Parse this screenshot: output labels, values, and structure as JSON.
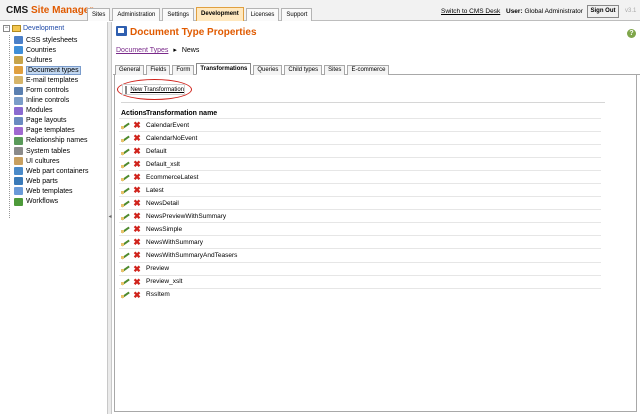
{
  "app": {
    "brand_cms": "CMS",
    "brand_sm": "Site Manager",
    "version": "v3.1"
  },
  "top_tabs": [
    {
      "label": "Sites",
      "active": false
    },
    {
      "label": "Administration",
      "active": false
    },
    {
      "label": "Settings",
      "active": false
    },
    {
      "label": "Development",
      "active": true
    },
    {
      "label": "Licenses",
      "active": false
    },
    {
      "label": "Support",
      "active": false
    }
  ],
  "header": {
    "switch_link": "Switch to CMS Desk",
    "user_prefix": "User:",
    "user_name": "Global Administrator",
    "signout_label": "Sign Out"
  },
  "tree": {
    "root_label": "Development",
    "items": [
      {
        "label": "CSS stylesheets",
        "icon": "stylesheet-icon",
        "color": "#4a7fc8",
        "selected": false
      },
      {
        "label": "Countries",
        "icon": "globe-icon",
        "color": "#3f8fd8",
        "selected": false
      },
      {
        "label": "Cultures",
        "icon": "culture-icon",
        "color": "#c7a44a",
        "selected": false
      },
      {
        "label": "Document types",
        "icon": "document-type-icon",
        "color": "#e0a040",
        "selected": true
      },
      {
        "label": "E-mail templates",
        "icon": "email-icon",
        "color": "#d6b56a",
        "selected": false
      },
      {
        "label": "Form controls",
        "icon": "form-control-icon",
        "color": "#5a7fb0",
        "selected": false
      },
      {
        "label": "Inline controls",
        "icon": "inline-control-icon",
        "color": "#7a9cc8",
        "selected": false
      },
      {
        "label": "Modules",
        "icon": "module-icon",
        "color": "#8a6ad0",
        "selected": false
      },
      {
        "label": "Page layouts",
        "icon": "page-layout-icon",
        "color": "#6a8ac0",
        "selected": false
      },
      {
        "label": "Page templates",
        "icon": "page-template-icon",
        "color": "#a06ad0",
        "selected": false
      },
      {
        "label": "Relationship names",
        "icon": "relationship-icon",
        "color": "#5a9a5a",
        "selected": false
      },
      {
        "label": "System tables",
        "icon": "system-table-icon",
        "color": "#8a8a8a",
        "selected": false
      },
      {
        "label": "UI cultures",
        "icon": "ui-culture-icon",
        "color": "#c8a060",
        "selected": false
      },
      {
        "label": "Web part containers",
        "icon": "webpart-container-icon",
        "color": "#4a8ac8",
        "selected": false
      },
      {
        "label": "Web parts",
        "icon": "webpart-icon",
        "color": "#3a7ab8",
        "selected": false
      },
      {
        "label": "Web templates",
        "icon": "web-template-icon",
        "color": "#6a9ad8",
        "selected": false
      },
      {
        "label": "Workflows",
        "icon": "workflow-icon",
        "color": "#4d9a3a",
        "selected": false
      }
    ]
  },
  "main": {
    "title": "Document Type Properties",
    "help_glyph": "?",
    "breadcrumb": {
      "link": "Document Types",
      "current": "News"
    },
    "tabs": [
      {
        "label": "General",
        "active": false
      },
      {
        "label": "Fields",
        "active": false
      },
      {
        "label": "Form",
        "active": false
      },
      {
        "label": "Transformations",
        "active": true
      },
      {
        "label": "Queries",
        "active": false
      },
      {
        "label": "Child types",
        "active": false
      },
      {
        "label": "Sites",
        "active": false
      },
      {
        "label": "E-commerce",
        "active": false
      }
    ],
    "new_transformation_label": "New Transformation",
    "grid": {
      "col_actions": "Actions",
      "col_name": "Transformation name",
      "rows": [
        "CalendarEvent",
        "CalendarNoEvent",
        "Default",
        "Default_xslt",
        "EcommerceLatest",
        "Latest",
        "NewsDetail",
        "NewsPreviewWithSummary",
        "NewsSimple",
        "NewsWithSummary",
        "NewsWithSummaryAndTeasers",
        "Preview",
        "Preview_xslt",
        "RssItem"
      ]
    }
  }
}
